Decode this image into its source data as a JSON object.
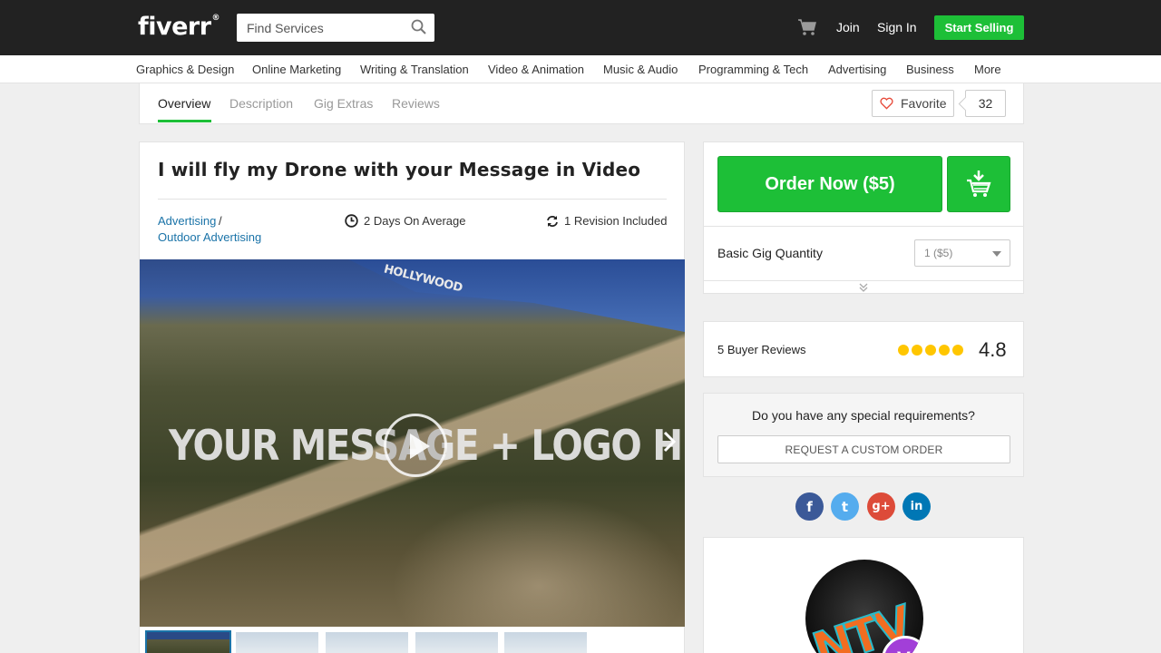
{
  "header": {
    "logo_text": "fiverr",
    "logo_mark": "®",
    "search_placeholder": "Find Services",
    "join": "Join",
    "sign_in": "Sign In",
    "start_selling": "Start Selling"
  },
  "categories": [
    "Graphics & Design",
    "Online Marketing",
    "Writing & Translation",
    "Video & Animation",
    "Music & Audio",
    "Programming & Tech",
    "Advertising",
    "Business",
    "More"
  ],
  "tabs": {
    "overview": "Overview",
    "description": "Description",
    "gig_extras": "Gig Extras",
    "reviews": "Reviews",
    "favorite": "Favorite",
    "favorite_count": "32"
  },
  "gig": {
    "title": "I will fly my Drone with your Message in Video",
    "category": "Advertising",
    "category_sep": "/",
    "subcategory": "Outdoor Advertising",
    "delivery": "2 Days On Average",
    "revisions": "1 Revision Included",
    "video_sign_text": "HOLLYWOOD",
    "video_overlay_text": "YOUR MESSAGE + LOGO HERE"
  },
  "order": {
    "button": "Order Now ($5)",
    "quantity_label": "Basic Gig Quantity",
    "quantity_value": "1 ($5)"
  },
  "reviews": {
    "label": "5 Buyer Reviews",
    "rating": "4.8",
    "stars_value": 5
  },
  "custom": {
    "question": "Do you have any special requirements?",
    "button": "REQUEST A CUSTOM ORDER"
  },
  "social": {
    "facebook": "f",
    "twitter": "t",
    "google": "g+",
    "linkedin": "in"
  },
  "seller": {
    "avatar_text": "NTV",
    "badge_text": "V"
  },
  "colors": {
    "brand_green": "#1dbf37",
    "header_bg": "#222222",
    "link_blue": "#1a73a8",
    "star_yellow": "#ffc600",
    "facebook": "#3b5998",
    "twitter": "#55acee",
    "google": "#dd4b39",
    "linkedin": "#0077b5"
  }
}
